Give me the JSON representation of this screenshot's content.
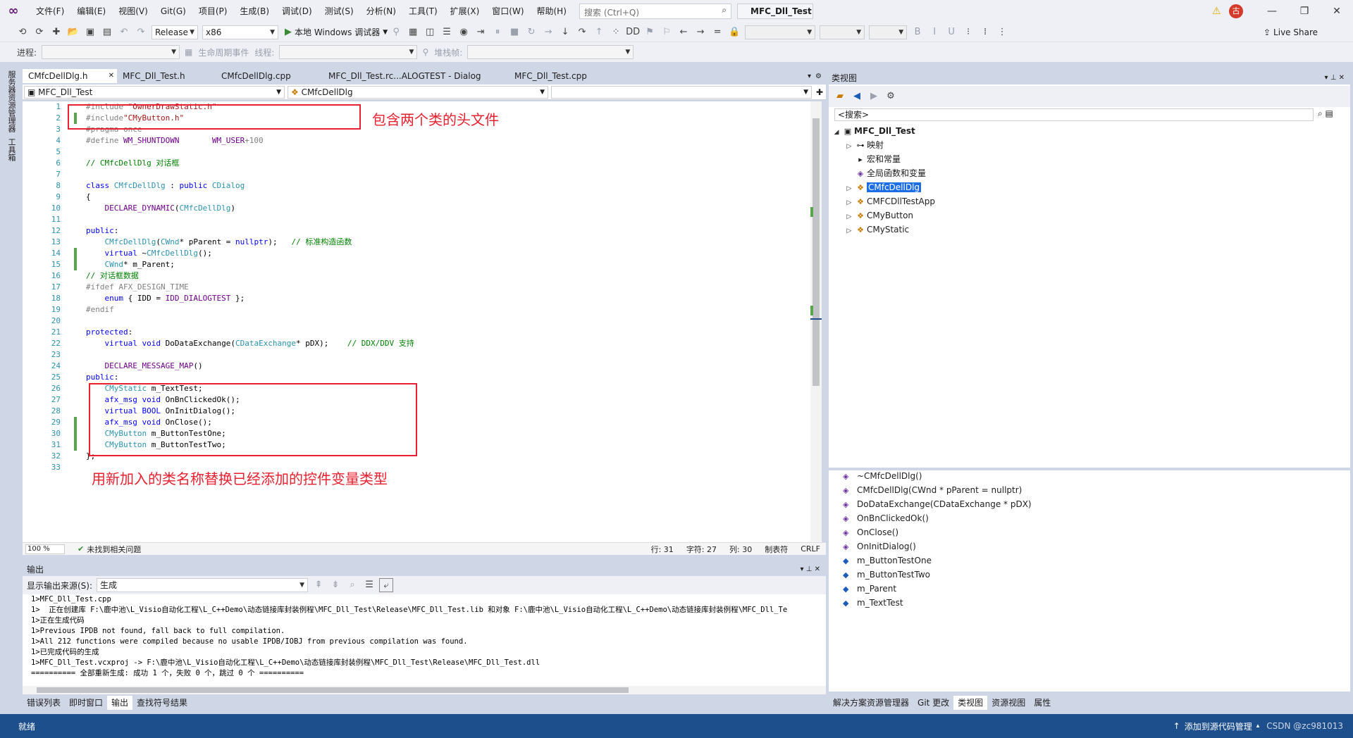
{
  "menubar": {
    "items": [
      "文件(F)",
      "编辑(E)",
      "视图(V)",
      "Git(G)",
      "项目(P)",
      "生成(B)",
      "调试(D)",
      "测试(S)",
      "分析(N)",
      "工具(T)",
      "扩展(X)",
      "窗口(W)",
      "帮助(H)"
    ],
    "search_placeholder": "搜索 (Ctrl+Q)",
    "solution_title": "MFC_Dll_Test"
  },
  "toolbar": {
    "config": "Release",
    "platform": "x86",
    "debugger": "本地 Windows 调试器",
    "live_share": "Live Share"
  },
  "toolbar2": {
    "process_label": "进程:",
    "lifecycle_label": "生命周期事件",
    "thread_label": "线程:",
    "stack_label": "堆栈帧:"
  },
  "left_tabs": [
    "服务器资源管理器",
    "工具箱"
  ],
  "doc_tabs": [
    "CMfcDellDlg.h",
    "MFC_Dll_Test.h",
    "CMfcDellDlg.cpp",
    "MFC_Dll_Test.rc...ALOGTEST - Dialog",
    "MFC_Dll_Test.cpp"
  ],
  "nav": {
    "project": "MFC_Dll_Test",
    "class": "CMfcDellDlg"
  },
  "code_lines": [
    "#include \"OwnerDrawStatic.h\"",
    "#include\"CMyButton.h\"",
    "#pragma once",
    "#define WM_SHUNTDOWN       WM_USER+100",
    "",
    "// CMfcDellDlg 对话框",
    "",
    "class CMfcDellDlg : public CDialog",
    "{",
    "    DECLARE_DYNAMIC(CMfcDellDlg)",
    "",
    "public:",
    "    CMfcDellDlg(CWnd* pParent = nullptr);   // 标准构造函数",
    "    virtual ~CMfcDellDlg();",
    "    CWnd* m_Parent;",
    "// 对话框数据",
    "#ifdef AFX_DESIGN_TIME",
    "    enum { IDD = IDD_DIALOGTEST };",
    "#endif",
    "",
    "protected:",
    "    virtual void DoDataExchange(CDataExchange* pDX);    // DDX/DDV 支持",
    "",
    "    DECLARE_MESSAGE_MAP()",
    "public:",
    "    CMyStatic m_TextTest;",
    "    afx_msg void OnBnClickedOk();",
    "    virtual BOOL OnInitDialog();",
    "    afx_msg void OnClose();",
    "    CMyButton m_ButtonTestOne;",
    "    CMyButton m_ButtonTestTwo;",
    "};",
    ""
  ],
  "annotations": {
    "top": "包含两个类的头文件",
    "bottom": "用新加入的类名称替换已经添加的控件变量类型"
  },
  "editor_status": {
    "zoom": "100 %",
    "issues": "未找到相关问题",
    "row": "行: 31",
    "char": "字符: 27",
    "col": "列: 30",
    "tab": "制表符",
    "eol": "CRLF"
  },
  "output": {
    "title": "输出",
    "source_label": "显示输出来源(S):",
    "source_value": "生成",
    "lines": [
      "1>MFC_Dll_Test.cpp",
      "1>  正在创建库 F:\\鹿中池\\L_Visio自动化工程\\L_C++Demo\\动态链接库封装例程\\MFC_Dll_Test\\Release\\MFC_Dll_Test.lib 和对象 F:\\鹿中池\\L_Visio自动化工程\\L_C++Demo\\动态链接库封装例程\\MFC_Dll_Te",
      "1>正在生成代码",
      "1>Previous IPDB not found, fall back to full compilation.",
      "1>All 212 functions were compiled because no usable IPDB/IOBJ from previous compilation was found.",
      "1>已完成代码的生成",
      "1>MFC_Dll_Test.vcxproj -> F:\\鹿中池\\L_Visio自动化工程\\L_C++Demo\\动态链接库封装例程\\MFC_Dll_Test\\Release\\MFC_Dll_Test.dll",
      "========== 全部重新生成: 成功 1 个，失败 0 个，跳过 0 个 =========="
    ]
  },
  "bottom_tabs": [
    "错误列表",
    "即时窗口",
    "输出",
    "查找符号结果"
  ],
  "class_view": {
    "title": "类视图",
    "search": "<搜索>",
    "root": "MFC_Dll_Test",
    "nodes": [
      "映射",
      "宏和常量",
      "全局函数和变量",
      "CMfcDellDlg",
      "CMFCDllTestApp",
      "CMyButton",
      "CMyStatic"
    ],
    "members": [
      "~CMfcDellDlg()",
      "CMfcDellDlg(CWnd * pParent = nullptr)",
      "DoDataExchange(CDataExchange * pDX)",
      "OnBnClickedOk()",
      "OnClose()",
      "OnInitDialog()",
      "m_ButtonTestOne",
      "m_ButtonTestTwo",
      "m_Parent",
      "m_TextTest"
    ]
  },
  "right_tabs": [
    "解决方案资源管理器",
    "Git 更改",
    "类视图",
    "资源视图",
    "属性"
  ],
  "statusbar": {
    "ready": "就绪",
    "add_source": "添加到源代码管理",
    "watermark": "CSDN @zc981013"
  }
}
